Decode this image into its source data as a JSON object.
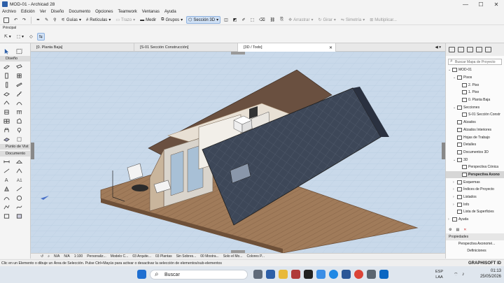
{
  "window": {
    "title": "MOD-01 - Archicad 28",
    "controls": [
      "—",
      "☐",
      "✕"
    ]
  },
  "menu": [
    "Archivo",
    "Edición",
    "Ver",
    "Diseño",
    "Documento",
    "Opciones",
    "Teamwork",
    "Ventanas",
    "Ayuda"
  ],
  "toolbar": {
    "guias": "Guías",
    "reticulas": "Retículas",
    "trazo": "Trazo",
    "medir": "Medir",
    "grupos": "Grupos",
    "seccion3d": "Sección 3D",
    "arrastrar": "Arrastrar",
    "girar": "Girar",
    "simetria": "Simetría",
    "multiplicar": "Multiplicar..."
  },
  "principal_label": "Principal",
  "toolbox": {
    "diseno": "Diseño",
    "punto_de_vista": "Punto de Vist",
    "documento": "Documento"
  },
  "tabs": [
    {
      "label": "[0. Planta Baja]"
    },
    {
      "label": "[S-01 Sección Construcción]"
    },
    {
      "label": "[3D / Todo]"
    }
  ],
  "viewbar": {
    "na1": "N/A",
    "na2": "N/A",
    "scale": "1:100",
    "personalizado": "Personaliz...",
    "modelo": "Modelo C...",
    "arquitectura": "03 Arquite...",
    "plantas": "03 Plantas",
    "sobres": "Sin Sobres...",
    "mostrar": "00 Mostra...",
    "modelo2": "Solo el Mo...",
    "colores": "Colores P..."
  },
  "navigator": {
    "search_placeholder": "Buscar Mapa de Proyecto",
    "tree": [
      {
        "label": "MOD-01",
        "indent": 0,
        "arrow": "⌄"
      },
      {
        "label": "Pisos",
        "indent": 1,
        "arrow": "⌄"
      },
      {
        "label": "2. Piso",
        "indent": 2,
        "arrow": ""
      },
      {
        "label": "1. Piso",
        "indent": 2,
        "arrow": ""
      },
      {
        "label": "0. Planta Baja",
        "indent": 2,
        "arrow": ""
      },
      {
        "label": "Secciones",
        "indent": 1,
        "arrow": "⌄"
      },
      {
        "label": "S-01 Sección Constr",
        "indent": 2,
        "arrow": ""
      },
      {
        "label": "Alzados",
        "indent": 1,
        "arrow": ""
      },
      {
        "label": "Alzados Interiores",
        "indent": 1,
        "arrow": ""
      },
      {
        "label": "Hojas de Trabajo",
        "indent": 1,
        "arrow": ""
      },
      {
        "label": "Detalles",
        "indent": 1,
        "arrow": ""
      },
      {
        "label": "Documentos 3D",
        "indent": 1,
        "arrow": ""
      },
      {
        "label": "3D",
        "indent": 1,
        "arrow": "⌄"
      },
      {
        "label": "Perspectiva Cónica",
        "indent": 2,
        "arrow": ""
      },
      {
        "label": "Perspectiva Axono",
        "indent": 2,
        "arrow": "",
        "selected": true
      },
      {
        "label": "Esquemas",
        "indent": 1,
        "arrow": "›"
      },
      {
        "label": "Índices de Proyecto",
        "indent": 1,
        "arrow": "›"
      },
      {
        "label": "Listados",
        "indent": 1,
        "arrow": "›"
      },
      {
        "label": "Info",
        "indent": 1,
        "arrow": "›"
      },
      {
        "label": "Lista de Superficies",
        "indent": 1,
        "arrow": ""
      },
      {
        "label": "Ayuda",
        "indent": 0,
        "arrow": "›"
      }
    ],
    "propiedades": "Propiedades",
    "perspectiva": "Perspectiva Axonomé...",
    "definiciones": "Definiciones"
  },
  "status": {
    "text": "Clic en un Elemento o dibuje un Área de Selección. Pulse Ctrl+Mayús para activar o desactivar la selección de elementos/sub-elementos",
    "brand": "GRAPHISOFT ID"
  },
  "taskbar": {
    "search": "Buscar",
    "lang_top": "ESP",
    "lang_bottom": "LAA",
    "time": "01:13",
    "date": "25/05/2026"
  },
  "colors": {
    "viewport_bg": "#c9d9ea",
    "roof": "#3c4657",
    "deck": "#9b7656",
    "accent": "#2d5fa8"
  }
}
